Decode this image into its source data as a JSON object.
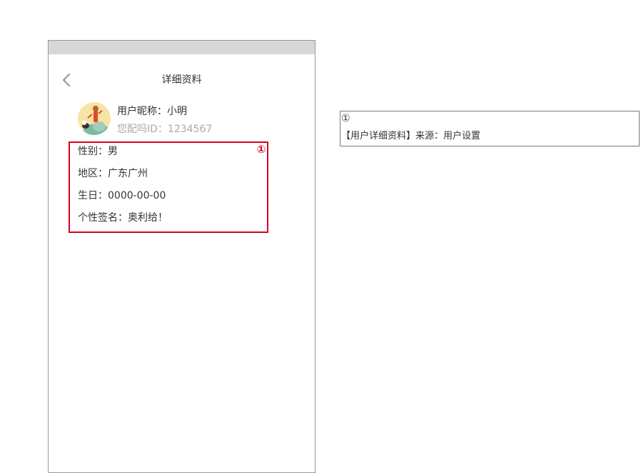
{
  "header": {
    "title": "详细资料",
    "back_icon": "chevron-left-icon"
  },
  "profile": {
    "nickname": "用户昵称：小明",
    "user_id": "您配吗ID：1234567",
    "avatar_icon": "avatar-illustration"
  },
  "details": [
    "性别：男",
    "地区：广东广州",
    "生日：0000-00-00",
    "个性签名：奥利给！"
  ],
  "annotation": {
    "marker": "①",
    "color": "#d9001b"
  },
  "note": {
    "marker": "①",
    "text": "【用户详细资料】来源：用户设置"
  },
  "colors": {
    "status_bar": "#d7d7d7",
    "secondary_text": "#aaaaaa",
    "primary_text": "#333333"
  }
}
